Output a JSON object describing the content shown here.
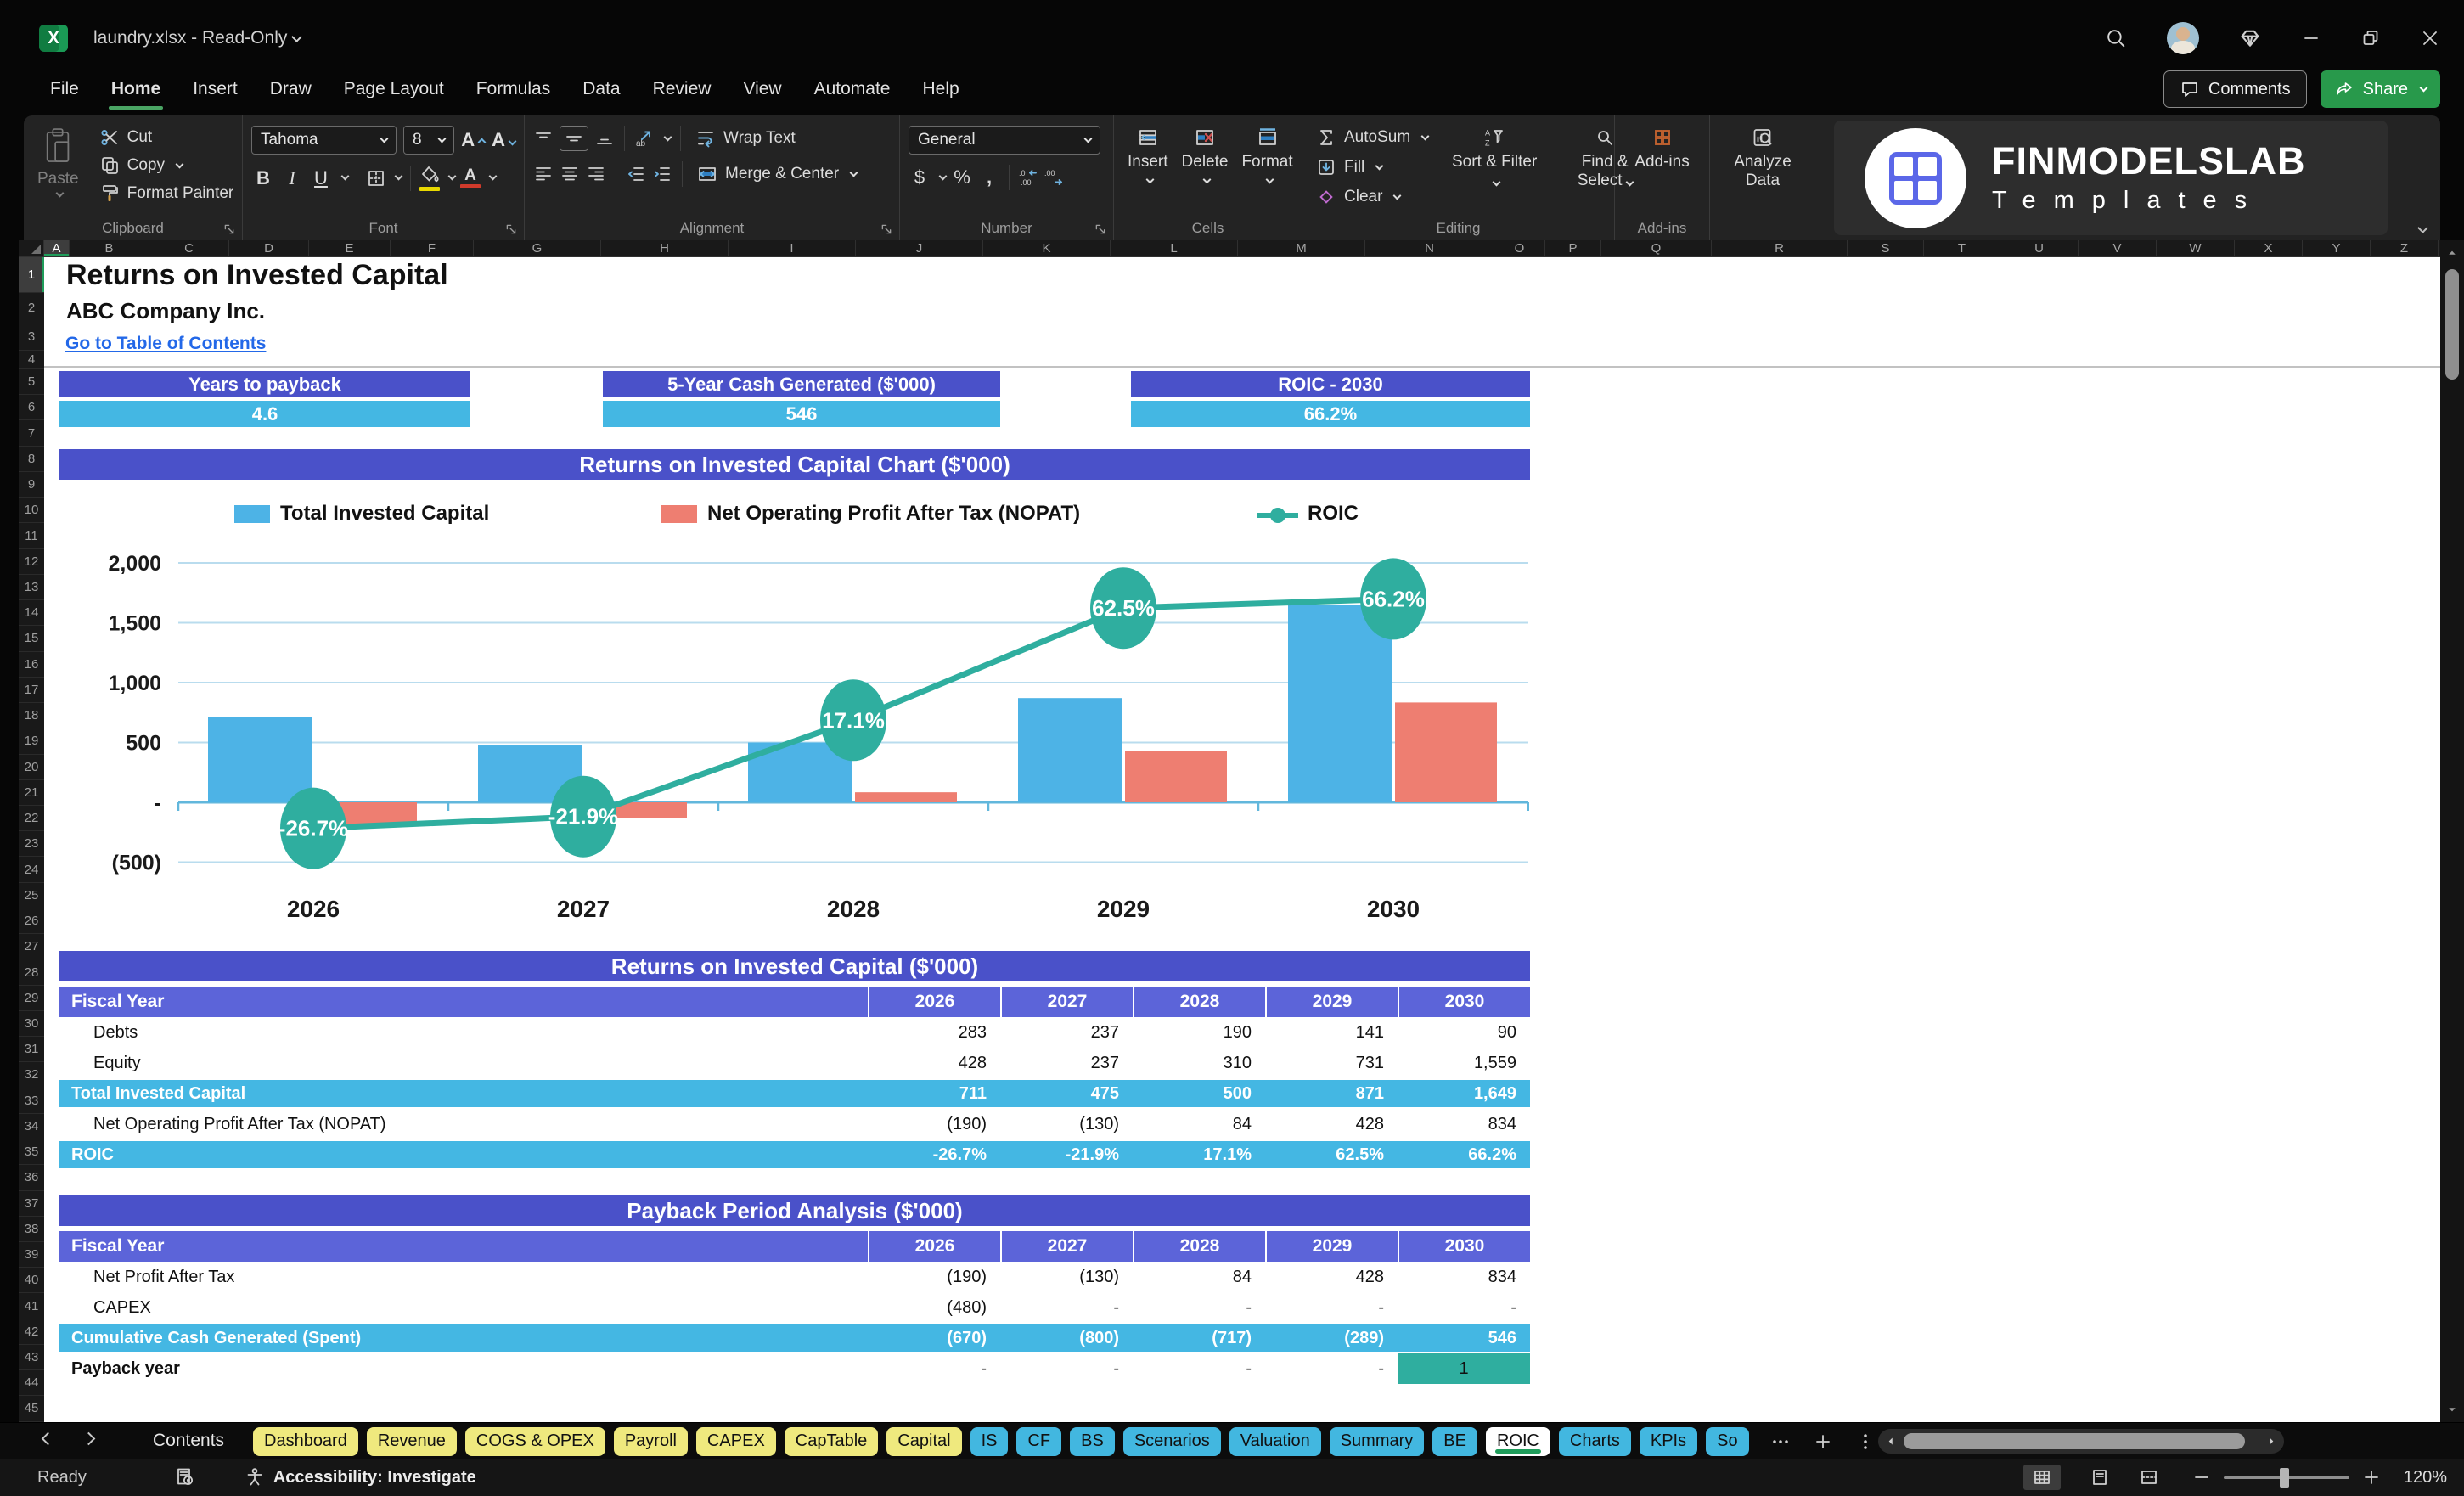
{
  "titlebar": {
    "title": "laundry.xlsx  -  Read-Only"
  },
  "menu": {
    "tabs": [
      "File",
      "Home",
      "Insert",
      "Draw",
      "Page Layout",
      "Formulas",
      "Data",
      "Review",
      "View",
      "Automate",
      "Help"
    ],
    "active_tab": "Home",
    "comments_label": "Comments",
    "share_label": "Share"
  },
  "ribbon": {
    "clipboard": {
      "paste": "Paste",
      "cut": "Cut",
      "copy": "Copy",
      "format_painter": "Format Painter",
      "group_label": "Clipboard"
    },
    "font": {
      "family": "Tahoma",
      "size": "8",
      "group_label": "Font"
    },
    "alignment": {
      "wrap_text": "Wrap Text",
      "merge_center": "Merge & Center",
      "group_label": "Alignment"
    },
    "number": {
      "format": "General",
      "group_label": "Number"
    },
    "cells": {
      "insert": "Insert",
      "delete": "Delete",
      "format": "Format",
      "group_label": "Cells"
    },
    "editing": {
      "autosum": "AutoSum",
      "fill": "Fill",
      "clear": "Clear",
      "sort_filter": "Sort & Filter",
      "find_select": "Find & Select",
      "group_label": "Editing"
    },
    "addins": {
      "label": "Add-ins",
      "group_label": "Add-ins"
    },
    "analyze": {
      "label": "Analyze Data"
    },
    "logo": {
      "brand": "FINMODELSLAB",
      "sub": "Templates"
    }
  },
  "sheet": {
    "columns": [
      {
        "l": "A",
        "w": 30
      },
      {
        "l": "B",
        "w": 94
      },
      {
        "l": "C",
        "w": 94
      },
      {
        "l": "D",
        "w": 94
      },
      {
        "l": "E",
        "w": 96
      },
      {
        "l": "F",
        "w": 98
      },
      {
        "l": "G",
        "w": 150
      },
      {
        "l": "H",
        "w": 150
      },
      {
        "l": "I",
        "w": 150
      },
      {
        "l": "J",
        "w": 150
      },
      {
        "l": "K",
        "w": 150
      },
      {
        "l": "L",
        "w": 150
      },
      {
        "l": "M",
        "w": 150
      },
      {
        "l": "N",
        "w": 152
      },
      {
        "l": "O",
        "w": 60
      },
      {
        "l": "P",
        "w": 66
      },
      {
        "l": "Q",
        "w": 130
      },
      {
        "l": "R",
        "w": 160
      },
      {
        "l": "S",
        "w": 90
      },
      {
        "l": "T",
        "w": 90
      },
      {
        "l": "U",
        "w": 92
      },
      {
        "l": "V",
        "w": 92
      },
      {
        "l": "W",
        "w": 92
      },
      {
        "l": "X",
        "w": 80
      },
      {
        "l": "Y",
        "w": 80
      },
      {
        "l": "Z",
        "w": 80
      }
    ],
    "visible_rows": 45,
    "selected_cell": "A1",
    "title": "Returns on Invested Capital",
    "company": "ABC Company Inc.",
    "link": "Go to Table of Contents"
  },
  "kpis": [
    {
      "label": "Years to payback",
      "value": "4.6"
    },
    {
      "label": "5-Year Cash Generated ($'000)",
      "value": "546"
    },
    {
      "label": "ROIC - 2030",
      "value": "66.2%"
    }
  ],
  "chart_data": {
    "type": "combo-bar-line",
    "title": "Returns on Invested Capital Chart ($'000)",
    "categories": [
      "2026",
      "2027",
      "2028",
      "2029",
      "2030"
    ],
    "series": [
      {
        "name": "Total Invested Capital",
        "type": "bar",
        "color": "#4db3e6",
        "values": [
          711,
          475,
          500,
          871,
          1649
        ]
      },
      {
        "name": "Net Operating Profit After Tax (NOPAT)",
        "type": "bar",
        "color": "#ee7e71",
        "values": [
          -190,
          -130,
          84,
          428,
          834
        ]
      },
      {
        "name": "ROIC",
        "type": "line",
        "axis": "percent",
        "color": "#2fae9f",
        "values": [
          -26.7,
          -21.9,
          17.1,
          62.5,
          66.2
        ],
        "labels": [
          "-26.7%",
          "-21.9%",
          "17.1%",
          "62.5%",
          "66.2%"
        ]
      }
    ],
    "y_ticks": [
      "2,000",
      "1,500",
      "1,000",
      "500",
      "-",
      "(500)"
    ],
    "y_tick_values": [
      2000,
      1500,
      1000,
      500,
      0,
      -500
    ],
    "ylim": [
      -800,
      2300
    ],
    "grid": true,
    "legend_position": "top"
  },
  "tables": [
    {
      "title": "Returns on Invested Capital ($'000)",
      "col_header": "Fiscal Year",
      "columns": [
        "2026",
        "2027",
        "2028",
        "2029",
        "2030"
      ],
      "rows": [
        {
          "label": "Debts",
          "values": [
            "283",
            "237",
            "190",
            "141",
            "90"
          ],
          "style": "plain",
          "indent": true
        },
        {
          "label": "Equity",
          "values": [
            "428",
            "237",
            "310",
            "731",
            "1,559"
          ],
          "style": "plain",
          "indent": true
        },
        {
          "label": "Total Invested Capital",
          "values": [
            "711",
            "475",
            "500",
            "871",
            "1,649"
          ],
          "style": "highlight",
          "indent": false
        },
        {
          "label": "Net Operating Profit After Tax (NOPAT)",
          "values": [
            "(190)",
            "(130)",
            "84",
            "428",
            "834"
          ],
          "style": "plain",
          "indent": true
        },
        {
          "label": "ROIC",
          "values": [
            "-26.7%",
            "-21.9%",
            "17.1%",
            "62.5%",
            "66.2%"
          ],
          "style": "highlight",
          "indent": false
        }
      ]
    },
    {
      "title": "Payback Period Analysis ($'000)",
      "col_header": "Fiscal Year",
      "columns": [
        "2026",
        "2027",
        "2028",
        "2029",
        "2030"
      ],
      "rows": [
        {
          "label": "Net Profit After Tax",
          "values": [
            "(190)",
            "(130)",
            "84",
            "428",
            "834"
          ],
          "style": "plain",
          "indent": true
        },
        {
          "label": "CAPEX",
          "values": [
            "(480)",
            "-",
            "-",
            "-",
            "-"
          ],
          "style": "plain",
          "indent": true
        },
        {
          "label": "Cumulative Cash Generated (Spent)",
          "values": [
            "(670)",
            "(800)",
            "(717)",
            "(289)",
            "546"
          ],
          "style": "highlight",
          "indent": false
        },
        {
          "label": "Payback year",
          "values": [
            "-",
            "-",
            "-",
            "-",
            "1"
          ],
          "style": "payback",
          "indent": false
        }
      ]
    }
  ],
  "sheet_tabs": {
    "first_sheet": "Contents",
    "active": "ROIC",
    "tabs": [
      {
        "label": "Dashboard",
        "color": "yellow"
      },
      {
        "label": "Revenue",
        "color": "yellow"
      },
      {
        "label": "COGS & OPEX",
        "color": "yellow"
      },
      {
        "label": "Payroll",
        "color": "yellow"
      },
      {
        "label": "CAPEX",
        "color": "yellow"
      },
      {
        "label": "CapTable",
        "color": "yellow"
      },
      {
        "label": "Capital",
        "color": "yellow"
      },
      {
        "label": "IS",
        "color": "blue"
      },
      {
        "label": "CF",
        "color": "blue"
      },
      {
        "label": "BS",
        "color": "blue"
      },
      {
        "label": "Scenarios",
        "color": "blue"
      },
      {
        "label": "Valuation",
        "color": "blue"
      },
      {
        "label": "Summary",
        "color": "blue"
      },
      {
        "label": "BE",
        "color": "blue"
      },
      {
        "label": "ROIC",
        "color": "active"
      },
      {
        "label": "Charts",
        "color": "blue"
      },
      {
        "label": "KPIs",
        "color": "blue"
      },
      {
        "label": "So",
        "color": "blue"
      }
    ]
  },
  "status_bar": {
    "mode": "Ready",
    "accessibility": "Accessibility: Investigate",
    "zoom": "120%"
  },
  "colors": {
    "purple_header": "#4a51c9",
    "fiscal_row": "#5c64d9",
    "light_blue": "#44b7e3",
    "teal": "#2fae9f",
    "salmon": "#ee7e71",
    "bar_blue": "#4db3e6",
    "link_blue": "#2368e8",
    "tab_yellow": "#efe97e",
    "tab_blue": "#42b7e0",
    "active_green": "#1f9d5b",
    "share_green": "#28994b",
    "gridline": "#b9dcee"
  }
}
